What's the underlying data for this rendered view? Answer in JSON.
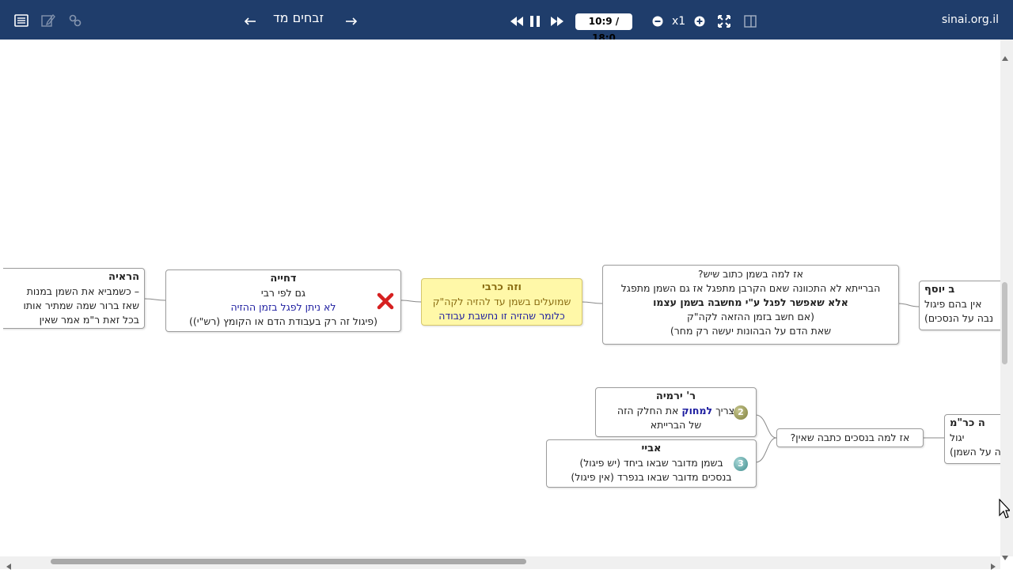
{
  "toolbar": {
    "title": "זבחים מד",
    "time": "10:9 / 18:0",
    "zoom": "x1",
    "site": "sinai.org.il"
  },
  "nodes": {
    "hareaya": {
      "head": "הראיה",
      "line1": "– כשמביא את השמן במנות",
      "line2": "שאז ברור שמה שמתיר אותו",
      "line3": "בכל זאת ר\"מ אמר שאין"
    },
    "dchiya": {
      "head": "דחייה",
      "line1": "גם לפי רבי",
      "line2": "לא ניתן לפגל בזמן ההזיה",
      "line3": "(פיגול זה רק בעבודת הדם או הקומץ (רש\"י))"
    },
    "vezeh": {
      "head": "וזה כרבי",
      "line1": "שמועלים בשמן עד להזיה לקה\"ק",
      "line2": "כלומר שהזיה זו נחשבת עבודה"
    },
    "az_lama_shemen": {
      "line1": "אז למה בשמן כתוב שיש?",
      "line2": "הברייתא לא התכוונה שאם הקרבן מתפגל אז גם השמן מתפגל",
      "line3": "אלא שאפשר לפגל ע\"י מחשבה בשמן עצמו",
      "line4": "(אם חשב בזמן ההזאה לקה\"ק",
      "line5": "שאת הדם על הבהונות יעשה רק מחר)"
    },
    "rav_yosef": {
      "head": "ב יוסף",
      "line1": "אין בהם פיגול",
      "line2": "נבה על הנסכים)"
    },
    "r_yirmiya": {
      "head": "ר' ירמיה",
      "pre": "צריך",
      "emph": "למחוק",
      "post": "את החלק הזה",
      "line2": "של הברייתא",
      "badge": "2"
    },
    "abaye": {
      "head": "אביי",
      "line1": "בשמן מדובר שבאו ביחד (יש פיגול)",
      "line2": "בנסכים מדובר שבאו בנפרד (אין פיגול)",
      "badge": "3"
    },
    "az_lama_nesachim": {
      "line1": "אז למה בנסכים כתבה שאין?"
    },
    "krm": {
      "head": "ה כר\"מ",
      "line1": "יגול",
      "line2": "ה על השמן)"
    }
  },
  "colors": {
    "topbar": "#1f3d6b",
    "node_yellow": "#fff8a8",
    "emphasis_blue": "#1d1da0",
    "reject_red": "#d62020"
  }
}
